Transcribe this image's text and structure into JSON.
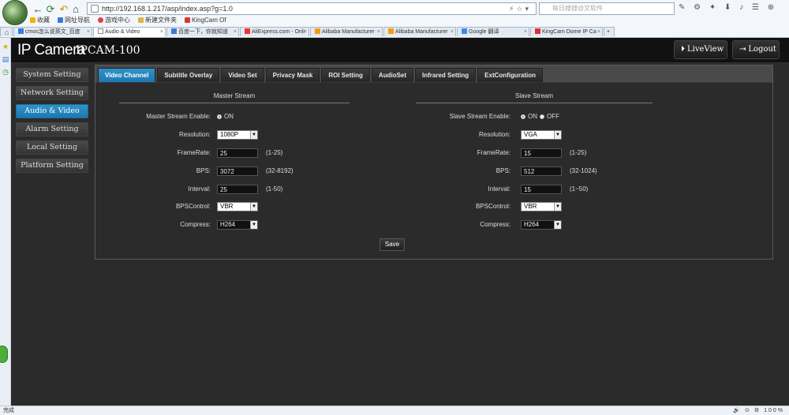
{
  "browser": {
    "address": "http://192.168.1.217/asp/index.asp?g=1.0",
    "search_placeholder": "每日搜搜@文软件",
    "bookmarks": [
      "收藏",
      "网址导航",
      "游戏中心",
      "新建文件夹",
      "KingCam Of"
    ],
    "tabs": [
      "cmos怎么说英文_百度",
      "Audio & Video",
      "百度一下，你就知道",
      "AliExpress.com - Onli",
      "Alibaba Manufacturer",
      "Alibaba Manufacturer",
      "Google 翻译",
      "KingCam Dome IP Ca"
    ],
    "status_left": "完成",
    "zoom": "100%"
  },
  "app": {
    "brand": "IP Camera",
    "model": "IPCAM-100",
    "liveview_label": "LiveView",
    "logout_label": "Logout"
  },
  "nav": [
    "System Setting",
    "Network Setting",
    "Audio & Video",
    "Alarm Setting",
    "Local Setting",
    "Platform Setting"
  ],
  "subtabs": [
    "Video Channel",
    "Subtitle Overlay",
    "Video Set",
    "Privacy Mask",
    "ROI Setting",
    "AudioSet",
    "Infrared Setting",
    "ExtConfiguration"
  ],
  "master": {
    "title": "Master Stream",
    "enable_label": "Master Stream Enable:",
    "enable_on": "ON",
    "resolution_label": "Resolution:",
    "resolution": "1080P",
    "framerate_label": "FrameRate:",
    "framerate": "25",
    "framerate_range": "(1-25)",
    "bps_label": "BPS:",
    "bps": "3072",
    "bps_range": "(32-8192)",
    "interval_label": "Interval:",
    "interval": "25",
    "interval_range": "(1-50)",
    "bpscontrol_label": "BPSControl:",
    "bpscontrol": "VBR",
    "compress_label": "Compress:",
    "compress": "H264"
  },
  "slave": {
    "title": "Slave Stream",
    "enable_label": "Slave Stream Enable:",
    "enable_on": "ON",
    "enable_off": "OFF",
    "resolution_label": "Resolution:",
    "resolution": "VGA",
    "framerate_label": "FrameRate:",
    "framerate": "15",
    "framerate_range": "(1-25)",
    "bps_label": "BPS:",
    "bps": "512",
    "bps_range": "(32-1024)",
    "interval_label": "Interval:",
    "interval": "15",
    "interval_range": "(1~50)",
    "bpscontrol_label": "BPSControl:",
    "bpscontrol": "VBR",
    "compress_label": "Compress:",
    "compress": "H264"
  },
  "save_label": "Save"
}
